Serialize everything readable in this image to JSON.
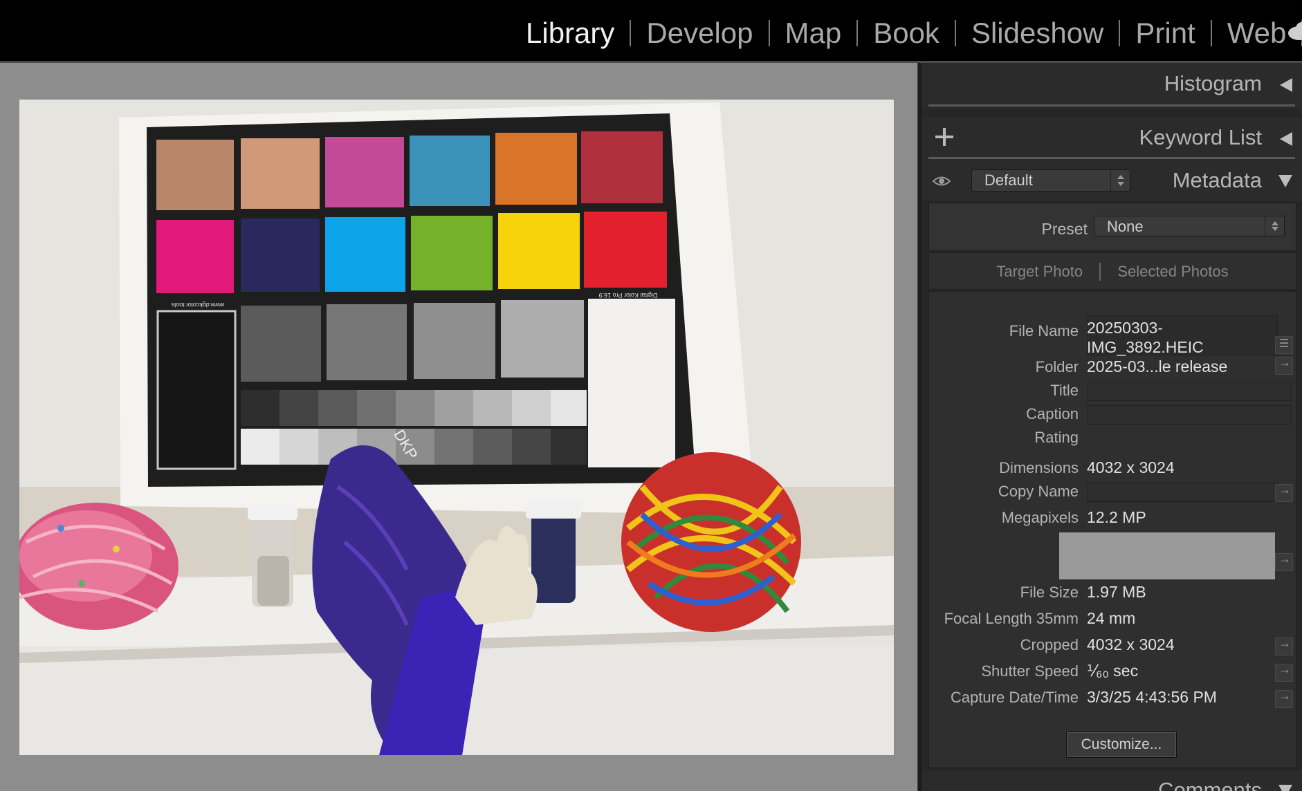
{
  "modules": [
    {
      "label": "Library",
      "active": true
    },
    {
      "label": "Develop",
      "active": false
    },
    {
      "label": "Map",
      "active": false
    },
    {
      "label": "Book",
      "active": false
    },
    {
      "label": "Slideshow",
      "active": false
    },
    {
      "label": "Print",
      "active": false
    },
    {
      "label": "Web",
      "active": false
    }
  ],
  "photo": {
    "chart_brand_text": "www.dgkcolor.tools",
    "chart_name_text": "Digital Kolor Pro 16:9",
    "logo_text": "DKP"
  },
  "panels": {
    "histogram": {
      "title": "Histogram"
    },
    "keyword_list": {
      "title": "Keyword List"
    },
    "metadata": {
      "title": "Metadata",
      "view_select": "Default",
      "preset_label": "Preset",
      "preset_value": "None",
      "target_photo": "Target Photo",
      "selected_photos": "Selected Photos",
      "fields": {
        "file_name_label": "File Name",
        "file_name_line1": "20250303-",
        "file_name_line2": "IMG_3892.HEIC",
        "folder_label": "Folder",
        "folder_value": "2025-03...le release",
        "title_label": "Title",
        "caption_label": "Caption",
        "rating_label": "Rating",
        "dimensions_label": "Dimensions",
        "dimensions_value": "4032 x 3024",
        "copy_name_label": "Copy Name",
        "megapixels_label": "Megapixels",
        "megapixels_value": "12.2 MP",
        "file_size_label": "File Size",
        "file_size_value": "1.97 MB",
        "focal_length_label": "Focal Length 35mm",
        "focal_length_value": "24 mm",
        "cropped_label": "Cropped",
        "cropped_value": "4032 x 3024",
        "shutter_label": "Shutter Speed",
        "shutter_value": "⅟₆₀ sec",
        "capture_label": "Capture Date/Time",
        "capture_value": "3/3/25 4:43:56 PM"
      },
      "customize_label": "Customize..."
    },
    "comments": {
      "title": "Comments"
    }
  }
}
